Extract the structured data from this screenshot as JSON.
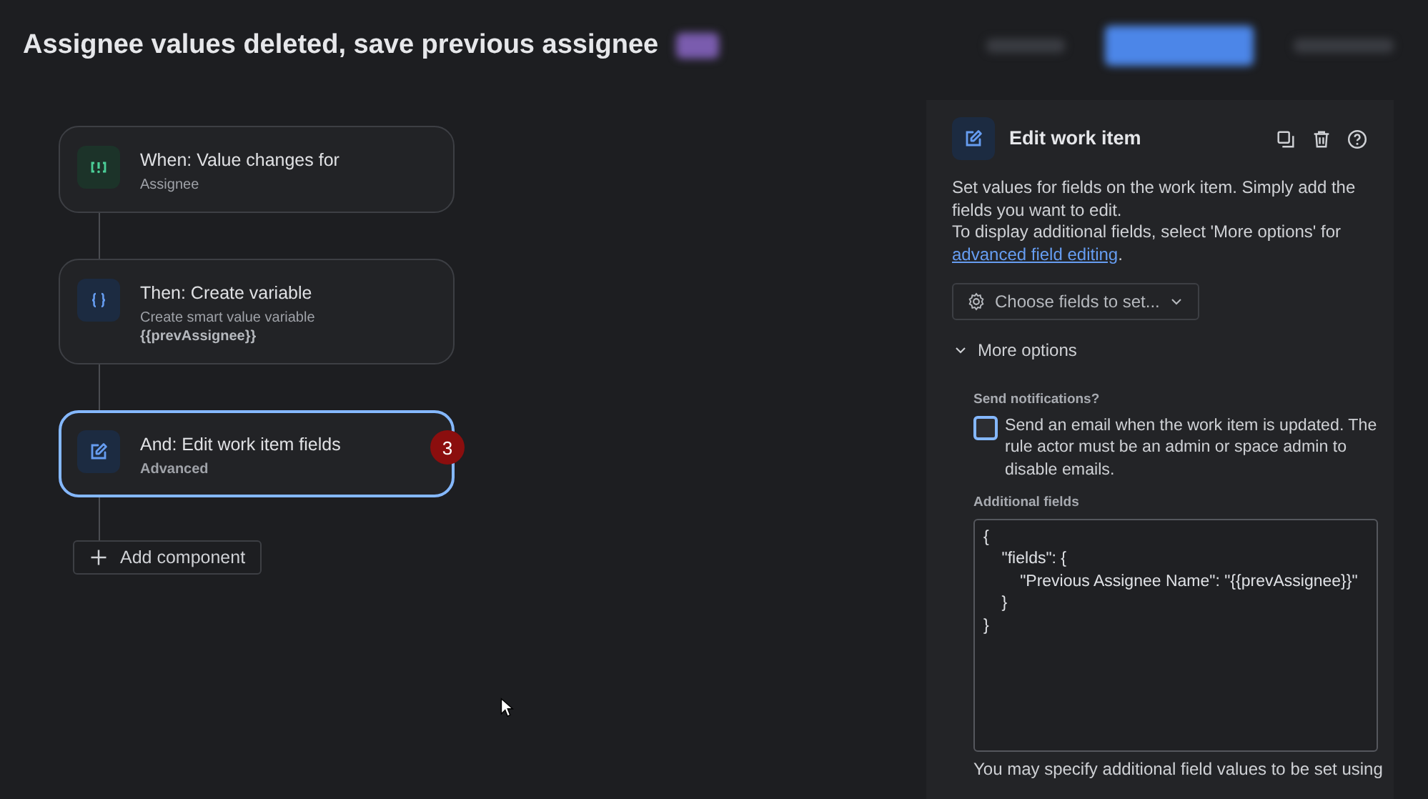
{
  "title": "Assignee values deleted, save previous assignee",
  "flow": {
    "steps": [
      {
        "kind": "trigger",
        "title": "When: Value changes for",
        "subtitle": "Assignee",
        "selected": false
      },
      {
        "kind": "variable",
        "title": "Then: Create variable",
        "subtitle": "Create smart value variable",
        "detail": "{{prevAssignee}}",
        "selected": false
      },
      {
        "kind": "edit",
        "title": "And: Edit work item fields",
        "subtitle": "Advanced",
        "selected": true,
        "badge": "3"
      }
    ],
    "add_button": "Add component"
  },
  "panel": {
    "title": "Edit work item",
    "description": "Set values for fields on the work item. Simply add the fields you want to edit.",
    "hint": "To display additional fields, select 'More options' for ",
    "link": "advanced field editing",
    "hint_end": ".",
    "choose_button": "Choose fields to set...",
    "more_options": {
      "label": "More options",
      "expanded": true
    },
    "notifications": {
      "label": "Send notifications?",
      "checked": false,
      "text": "Send an email when the work item is updated. The rule actor must be an admin or space admin to disable emails."
    },
    "additional_fields": {
      "label": "Additional fields",
      "value": "{\n    \"fields\": {\n        \"Previous Assignee Name\": \"{{prevAssignee}}\"\n    }\n}"
    },
    "footer": "You may specify additional field values to be set using"
  }
}
